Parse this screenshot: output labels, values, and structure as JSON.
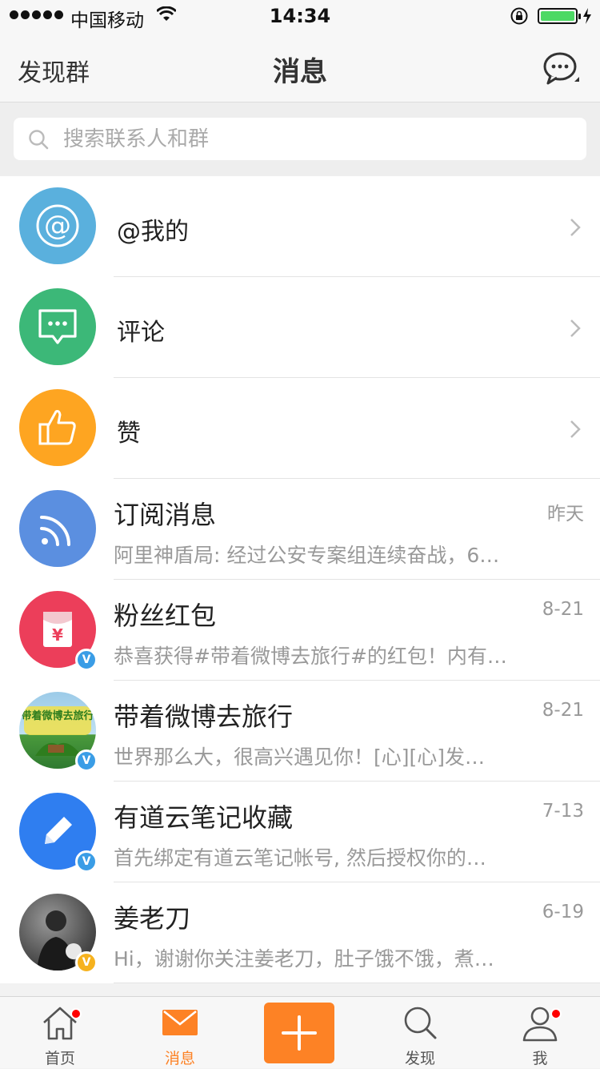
{
  "status_bar": {
    "carrier": "中国移动",
    "time": "14:34"
  },
  "navbar": {
    "left_label": "发现群",
    "title": "消息"
  },
  "search": {
    "placeholder": "搜索联系人和群"
  },
  "shortcuts": [
    {
      "label": "@我的",
      "icon": "at-icon",
      "color": "#5ab0dd"
    },
    {
      "label": "评论",
      "icon": "comment-icon",
      "color": "#3cb878"
    },
    {
      "label": "赞",
      "icon": "thumbs-up-icon",
      "color": "#fea521"
    }
  ],
  "messages": [
    {
      "name": "订阅消息",
      "preview": "阿里神盾局: 经过公安专案组连续奋战，6…",
      "time": "昨天",
      "icon": "rss-icon",
      "color": "#5b8fe0"
    },
    {
      "name": "粉丝红包",
      "preview": "恭喜获得#带着微博去旅行#的红包！内有…",
      "time": "8-21",
      "icon": "red-envelope-icon",
      "color": "#ec3e5a",
      "badge_color": "#3a9de6"
    },
    {
      "name": "带着微博去旅行",
      "preview": "世界那么大，很高兴遇见你！[心][心]发…",
      "time": "8-21",
      "icon": "travel-avatar",
      "color": "#9ccbe8",
      "badge_color": "#3a9de6",
      "avatar_text": "#带着微博去旅行#"
    },
    {
      "name": "有道云笔记收藏",
      "preview": "首先绑定有道云笔记帐号, 然后授权你的…",
      "time": "7-13",
      "icon": "pencil-icon",
      "color": "#2f7ef0",
      "badge_color": "#3a9de6"
    },
    {
      "name": "姜老刀",
      "preview": "Hi，谢谢你关注姜老刀，肚子饿不饿，煮…",
      "time": "6-19",
      "icon": "user-photo-avatar",
      "color": "#555555",
      "badge_color": "#f6b21e"
    }
  ],
  "tabbar": {
    "home": "首页",
    "messages": "消息",
    "discover": "发现",
    "me": "我"
  },
  "colors": {
    "accent": "#fd8225",
    "notification_dot": "#ff1a1a"
  }
}
